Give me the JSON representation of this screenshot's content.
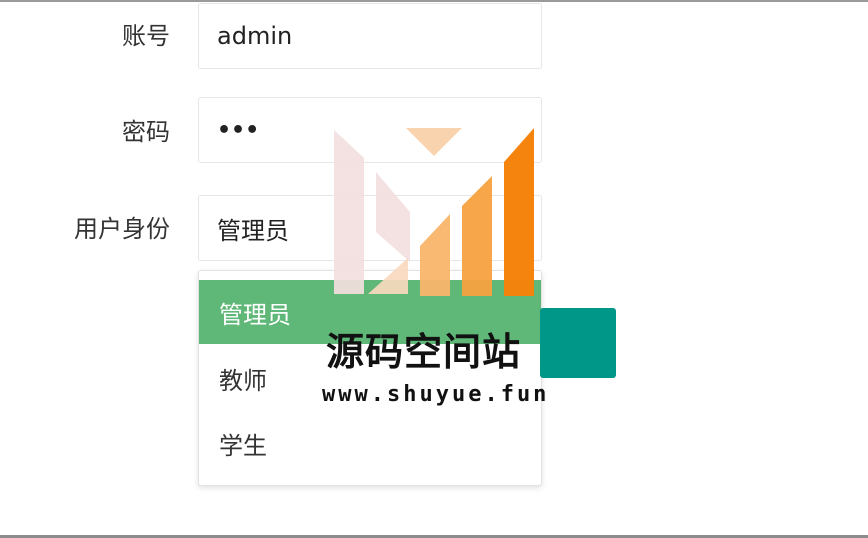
{
  "form": {
    "account_label": "账号",
    "account_value": "admin",
    "password_label": "密码",
    "password_value": "•••",
    "role_label": "用户身份",
    "role_value": "管理员",
    "role_options": [
      "管理员",
      "教师",
      "学生"
    ],
    "selected_option_index": 0
  },
  "watermark": {
    "title": "源码空间站",
    "url": "www.shuyue.fun"
  },
  "colors": {
    "selected_option_bg": "#5fb878",
    "submit_button": "#009688",
    "watermark_orange": "#f5820a",
    "watermark_light_orange": "#f9b56b",
    "watermark_pink": "#f3dede"
  }
}
